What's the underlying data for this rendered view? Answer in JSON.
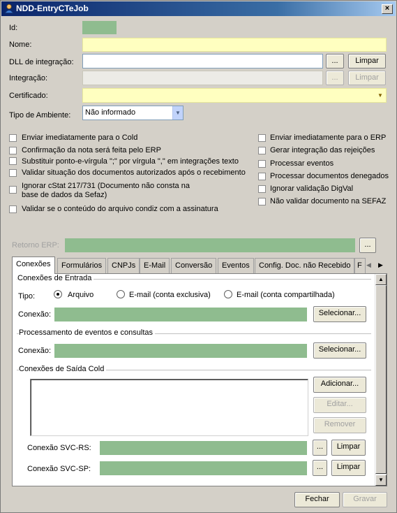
{
  "window": {
    "title": "NDD-EntryCTeJob",
    "close": "×"
  },
  "form": {
    "id_label": "Id:",
    "nome_label": "Nome:",
    "dll_label": "DLL de integração:",
    "integracao_label": "Integração:",
    "certificado_label": "Certificado:",
    "tipo_ambiente_label": "Tipo de Ambiente:",
    "tipo_ambiente_value": "Não informado",
    "browse": "...",
    "limpar": "Limpar",
    "dropdown_arrow": "▼"
  },
  "checkboxes_left": [
    "Enviar imediatamente para o Cold",
    "Confirmação da nota será feita pelo ERP",
    "Substituir ponto-e-vírgula \";\" por vírgula \",\" em integrações texto",
    "Validar situação dos documentos autorizados após o recebimento",
    "Ignorar cStat 217/731 (Documento não consta na",
    "base de dados da Sefaz)",
    "Validar se o conteúdo do arquivo condiz com a assinatura"
  ],
  "checkboxes_right": [
    "Enviar imediatamente para o ERP",
    "Gerar integração das rejeições",
    "Processar eventos",
    "Processar documentos denegados",
    "Ignorar validação DigVal",
    "Não validar documento na SEFAZ"
  ],
  "retorno_label": "Retorno ERP:",
  "tabs": [
    "Conexões",
    "Formulários",
    "CNPJs",
    "E-Mail",
    "Conversão",
    "Eventos",
    "Config. Doc. não Recebido",
    "F"
  ],
  "tab_nav": {
    "left": "◀",
    "right": "▶"
  },
  "conexoes": {
    "entrada_title": "Conexões de Entrada",
    "tipo_label": "Tipo:",
    "radio_arquivo": "Arquivo",
    "radio_email_excl": "E-mail (conta exclusiva)",
    "radio_email_comp": "E-mail (conta compartilhada)",
    "conexao_label": "Conexão:",
    "selecionar": "Selecionar...",
    "processamento_title": "Processamento de eventos e consultas",
    "saida_title": "Conexões de Saída Cold",
    "adicionar": "Adicionar...",
    "editar": "Editar...",
    "remover": "Remover",
    "svc_rs_label": "Conexão SVC-RS:",
    "svc_sp_label": "Conexão SVC-SP:"
  },
  "scroll": {
    "up": "▲",
    "down": "▼"
  },
  "footer": {
    "fechar": "Fechar",
    "gravar": "Gravar"
  }
}
